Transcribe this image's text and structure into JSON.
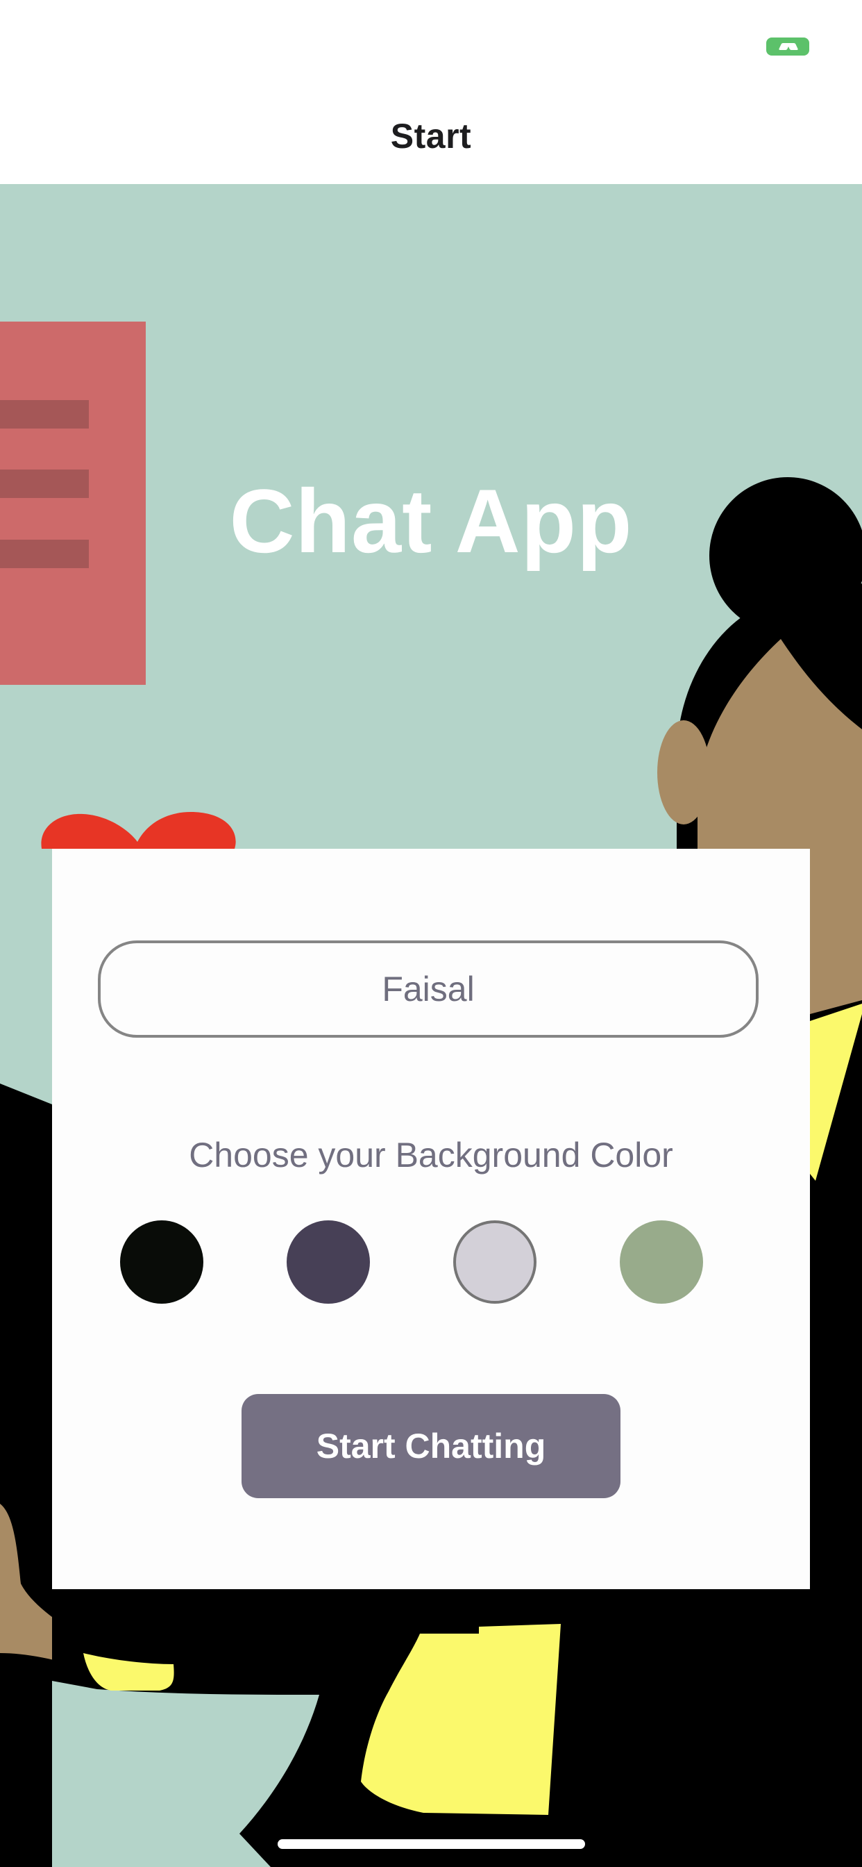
{
  "nav": {
    "title": "Start"
  },
  "hero": {
    "app_title": "Chat App"
  },
  "form": {
    "name_value": "Faisal",
    "color_label": "Choose your Background Color",
    "swatches": [
      {
        "name": "black",
        "color": "#090c08"
      },
      {
        "name": "dark-purple",
        "color": "#474056"
      },
      {
        "name": "light-gray",
        "color": "#d3d0d8",
        "selected": true
      },
      {
        "name": "sage-green",
        "color": "#98ab8b"
      }
    ],
    "start_button_label": "Start Chatting"
  },
  "colors": {
    "background": "#b4d4c9",
    "button": "#757083",
    "status_indicator": "#5cc16a"
  }
}
